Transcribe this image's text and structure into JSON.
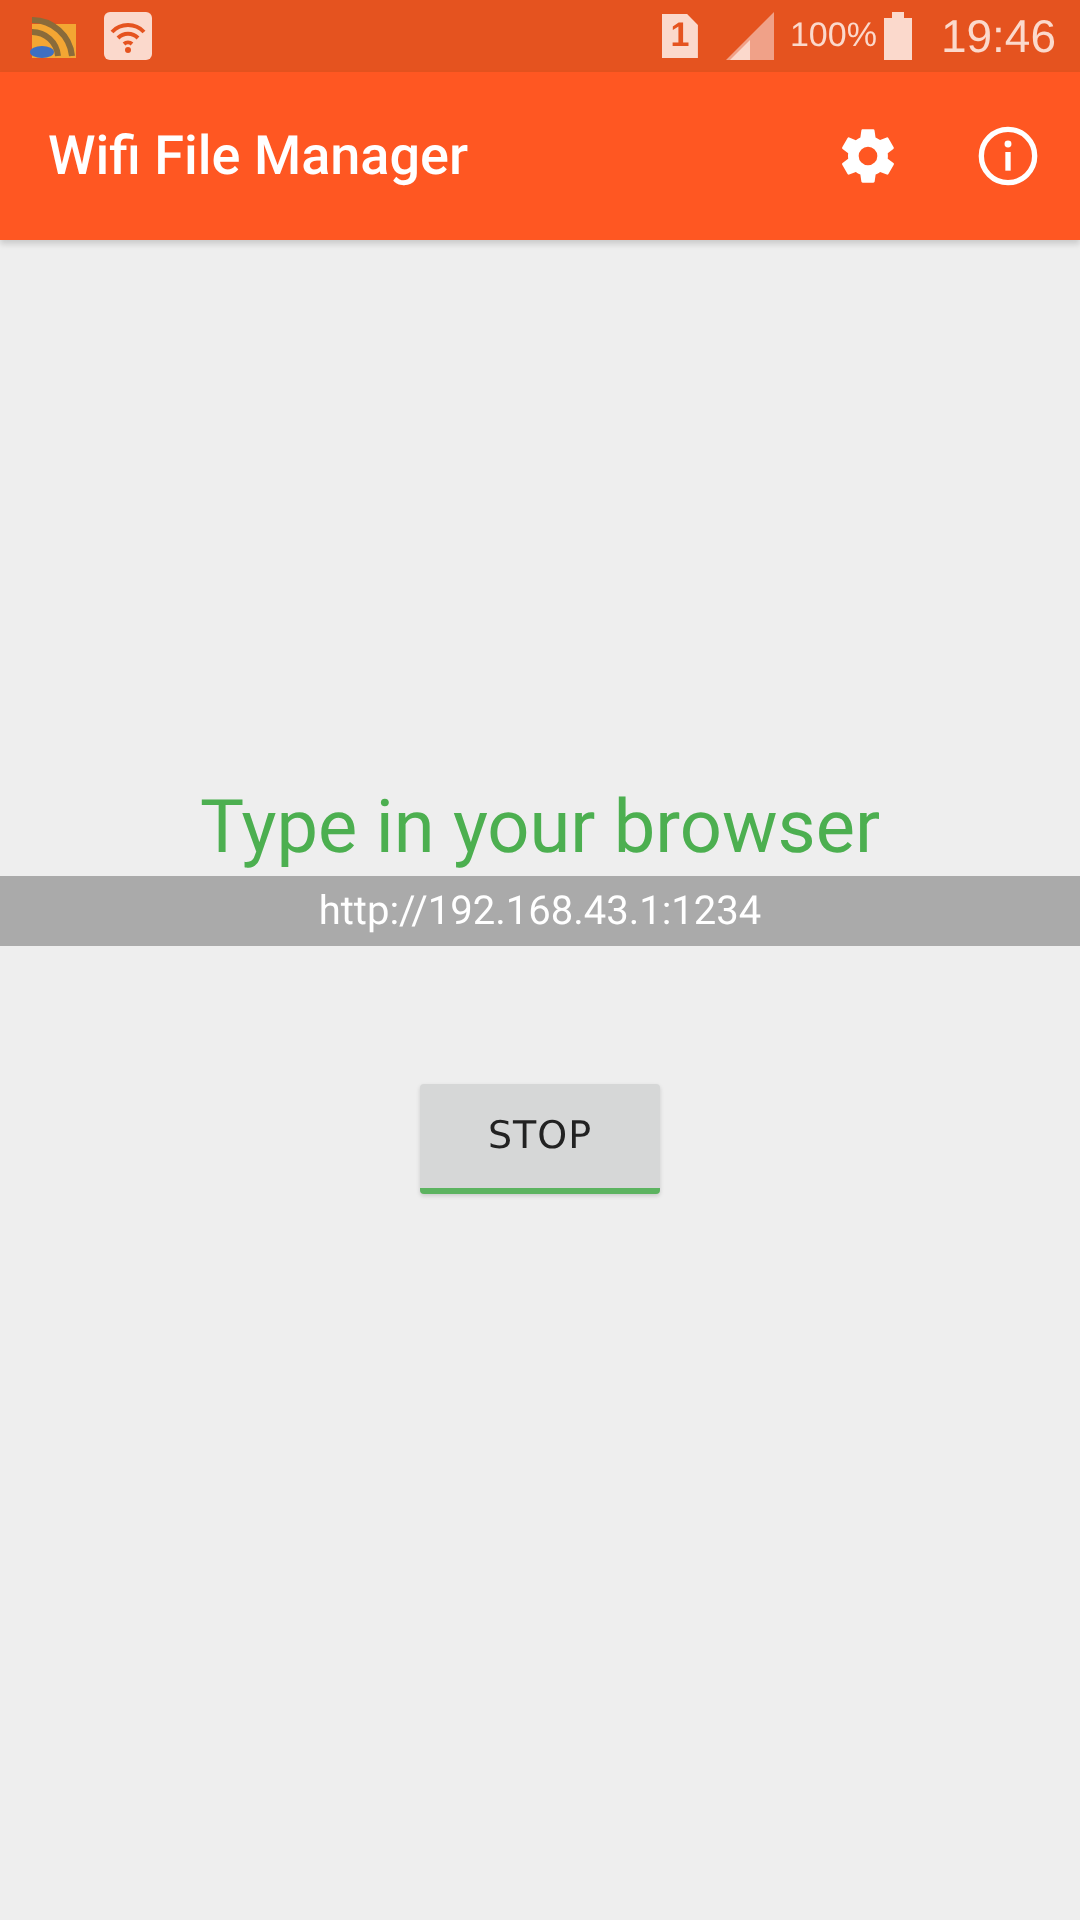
{
  "status_bar": {
    "sim_slot": "1",
    "battery": "100%",
    "time": "19:46"
  },
  "app_bar": {
    "title": "Wifi File Manager"
  },
  "server": {
    "heading": "Type in your browser",
    "address": "http://192.168.43.1:1234",
    "button": "STOP"
  }
}
